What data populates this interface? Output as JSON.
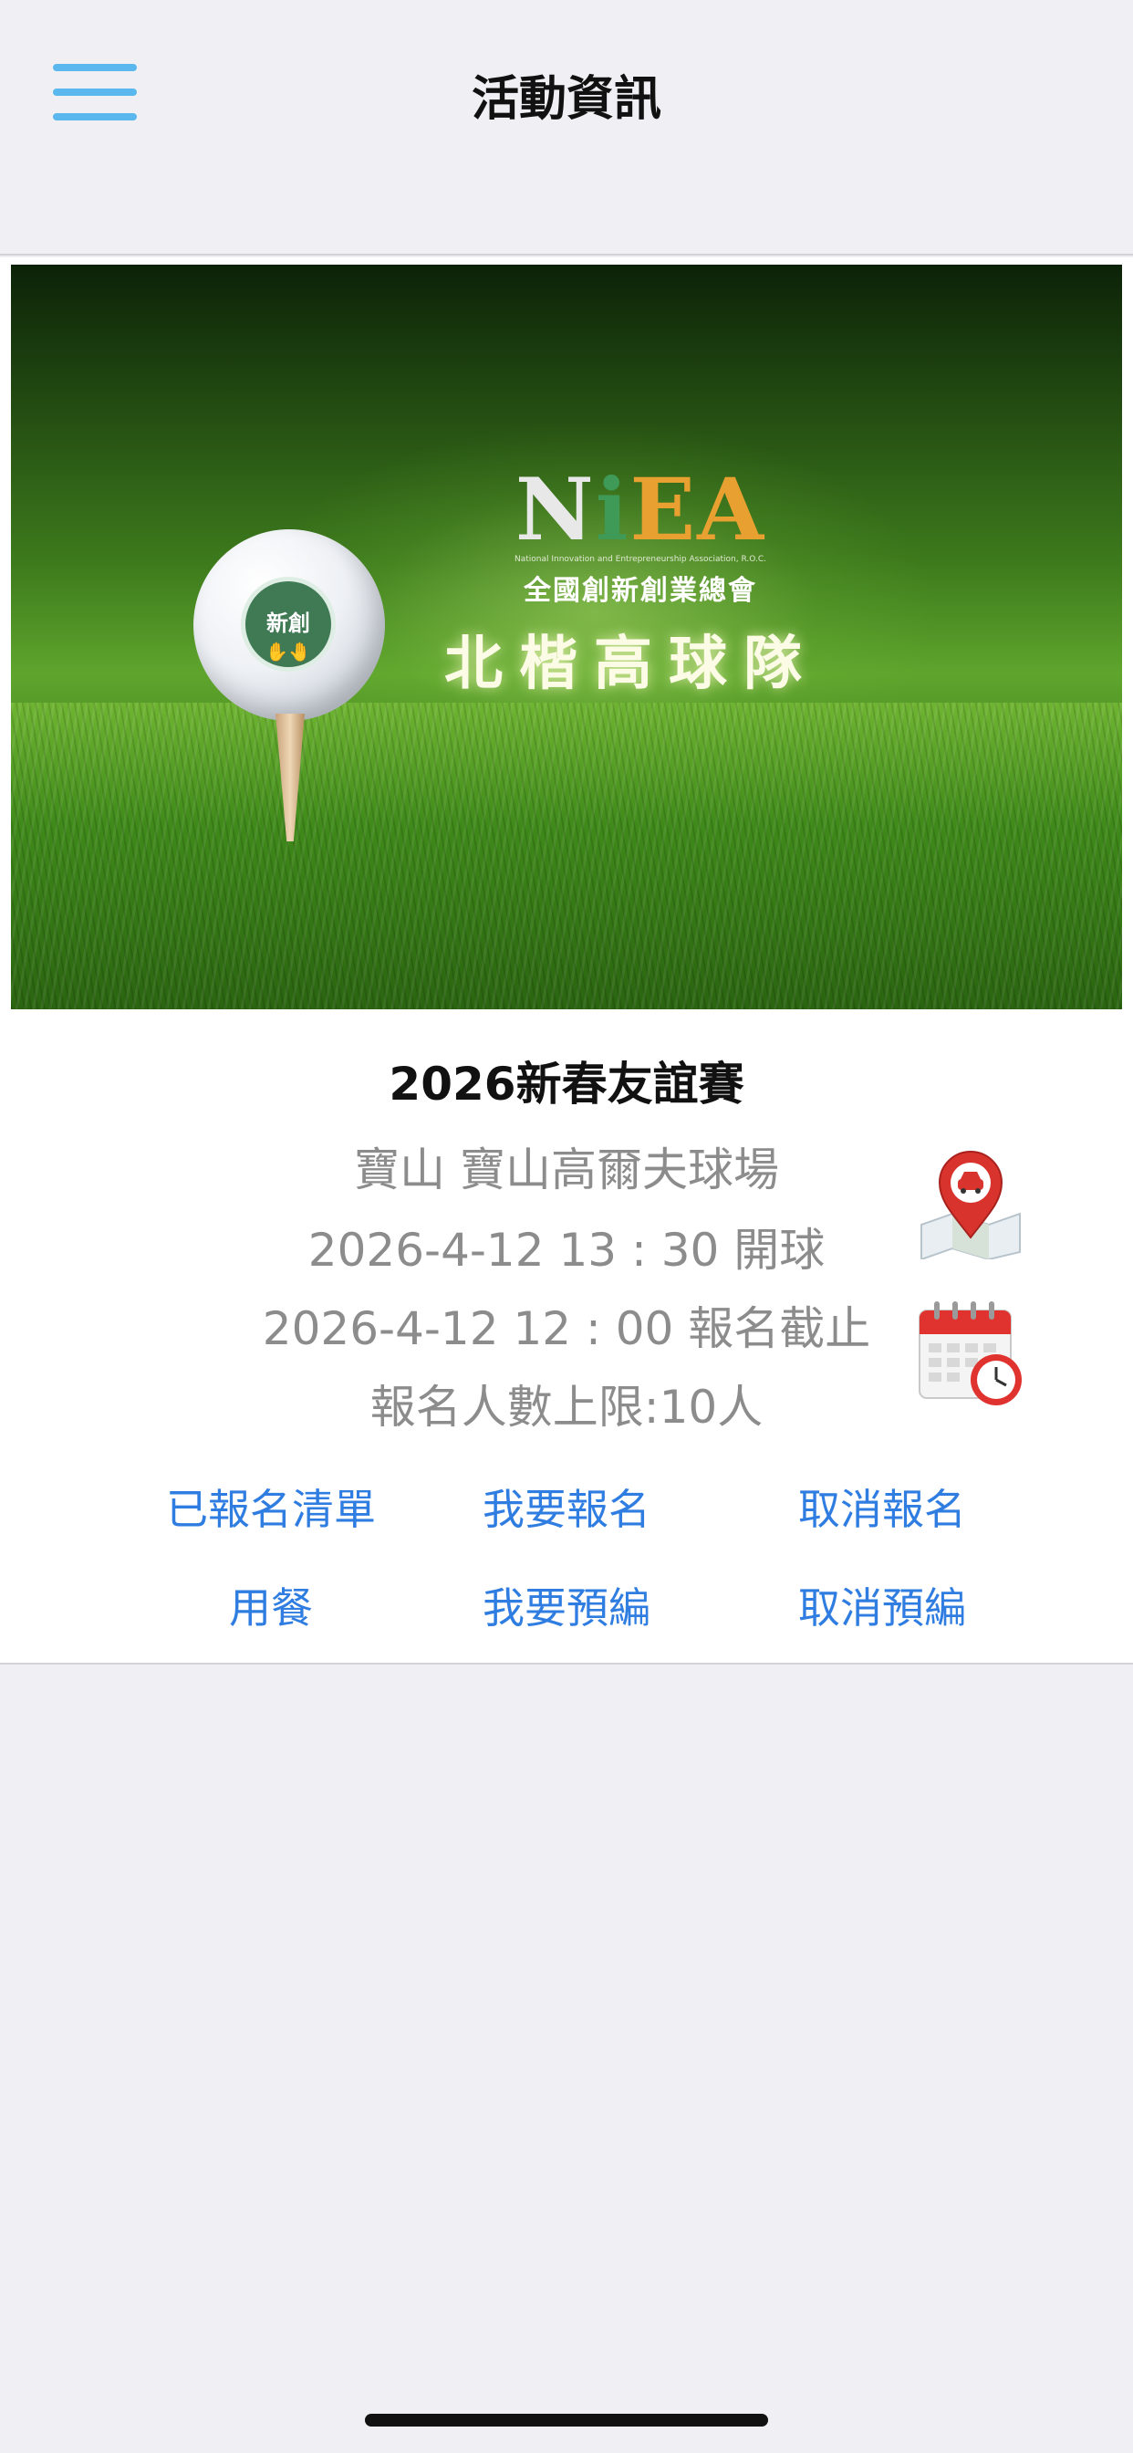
{
  "nav": {
    "title": "活動資訊",
    "menu_icon": "hamburger-menu-icon",
    "accent_color": "#5ab8ee"
  },
  "banner": {
    "logo_word": [
      "N",
      "i",
      "E",
      "A"
    ],
    "logo_subtitle": "National Innovation and Entrepreneurship Association, R.O.C.",
    "logo_chinese": "全國創新創業總會",
    "ball_emblem": "新創",
    "team_name": "北楷高球隊"
  },
  "event": {
    "title": "2026新春友誼賽",
    "location": "寶山 寶山高爾夫球場",
    "tee_off": "2026-4-12 13 : 30 開球",
    "deadline": "2026-4-12  12 : 00 報名截止",
    "capacity": "報名人數上限:10人",
    "map_icon": "map-pin-car-icon",
    "calendar_icon": "calendar-clock-icon"
  },
  "actions": {
    "registered_list": "已報名清單",
    "register": "我要報名",
    "cancel_register": "取消報名",
    "meal": "用餐",
    "pre_group": "我要預編",
    "cancel_pre_group": "取消預編",
    "link_color": "#2f7de1"
  }
}
